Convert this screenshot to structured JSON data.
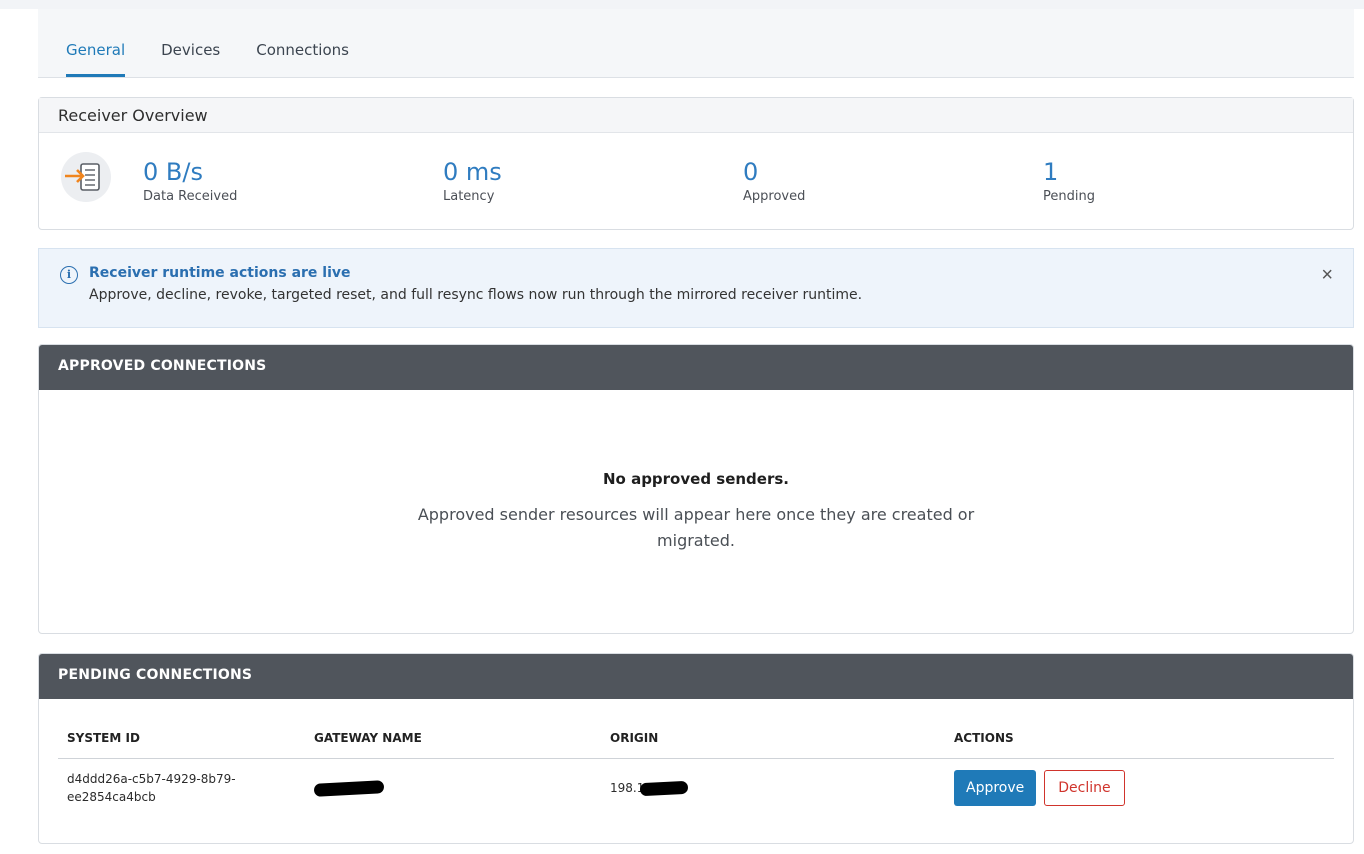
{
  "tabs": [
    {
      "label": "General",
      "active": true
    },
    {
      "label": "Devices",
      "active": false
    },
    {
      "label": "Connections",
      "active": false
    }
  ],
  "overview": {
    "title": "Receiver Overview",
    "icon": "receiver-server-icon",
    "stats": [
      {
        "value": "0 B/s",
        "label": "Data Received"
      },
      {
        "value": "0 ms",
        "label": "Latency"
      },
      {
        "value": "0",
        "label": "Approved"
      },
      {
        "value": "1",
        "label": "Pending"
      }
    ]
  },
  "alert": {
    "icon": "info-icon",
    "title": "Receiver runtime actions are live",
    "message": "Approve, decline, revoke, targeted reset, and full resync flows now run through the mirrored receiver runtime.",
    "close_glyph": "×"
  },
  "approved": {
    "title": "APPROVED CONNECTIONS",
    "empty_title": "No approved senders.",
    "empty_message": "Approved sender resources will appear here once they are created or migrated."
  },
  "pending": {
    "title": "PENDING CONNECTIONS",
    "columns": [
      "SYSTEM ID",
      "GATEWAY NAME",
      "ORIGIN",
      "ACTIONS"
    ],
    "rows": [
      {
        "system_id_line1": "d4ddd26a-c5b7-4929-8b79-",
        "system_id_line2": "ee2854ca4bcb",
        "gateway_name": "",
        "origin_prefix": "198.1",
        "approve_label": "Approve",
        "decline_label": "Decline"
      }
    ]
  },
  "colors": {
    "accent": "#1f7ab8",
    "panel_header": "#50555c",
    "danger": "#d0342c",
    "alert_bg": "#eef4fb"
  }
}
